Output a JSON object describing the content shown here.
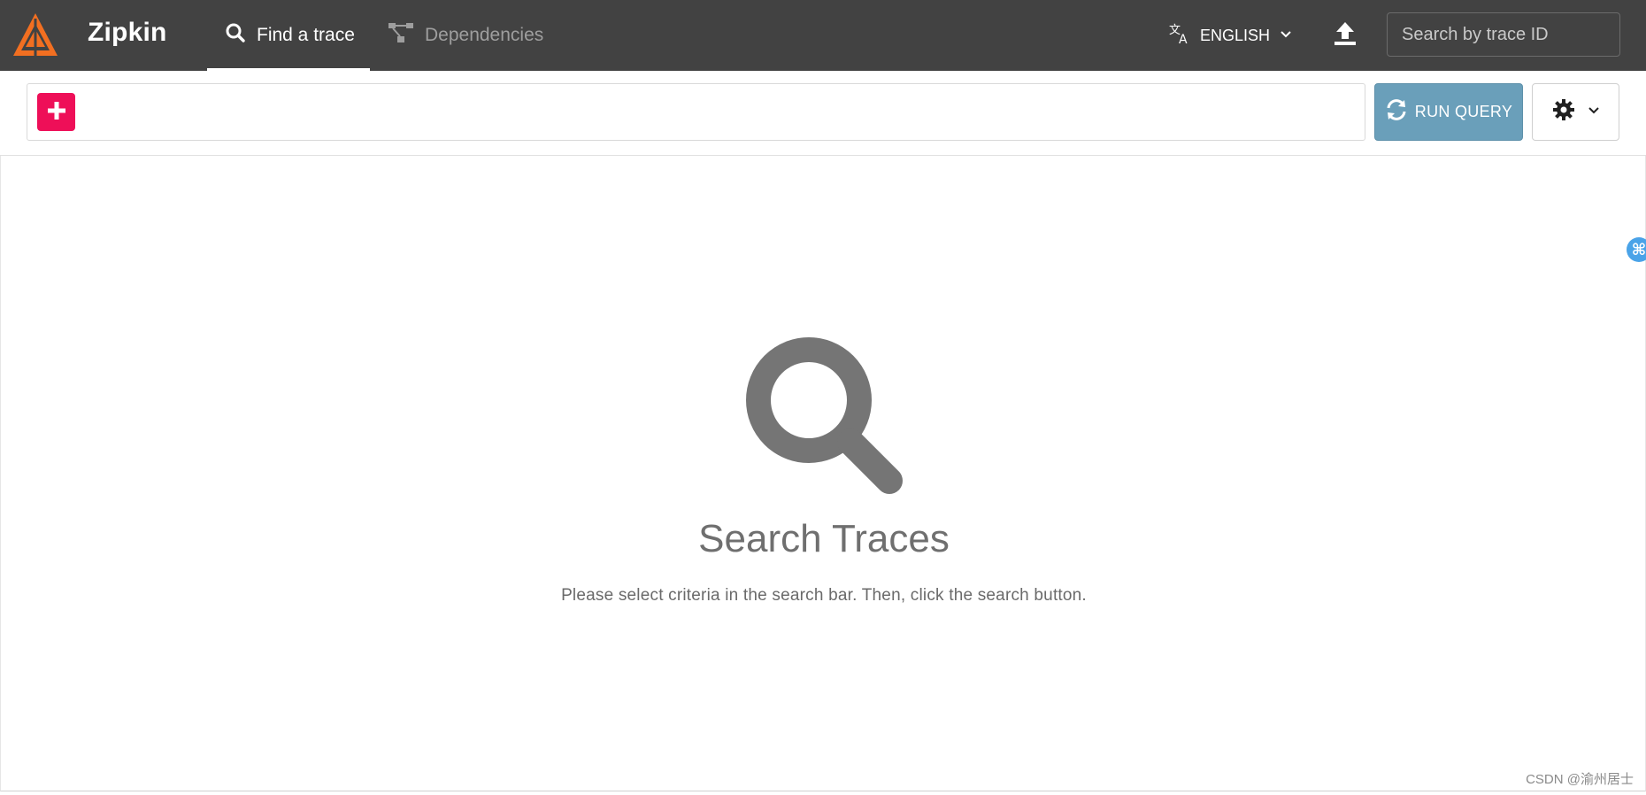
{
  "app": {
    "name": "Zipkin",
    "logo_icon": "zipkin-logo-icon",
    "brand_color": "#f26f21"
  },
  "nav": {
    "tabs": [
      {
        "label": "Find a trace",
        "icon": "search-icon",
        "active": true
      },
      {
        "label": "Dependencies",
        "icon": "dependencies-icon",
        "active": false
      }
    ]
  },
  "header": {
    "language_label": "ENGLISH",
    "language_icon": "translate-icon",
    "upload_icon": "upload-icon",
    "trace_search_placeholder": "Search by trace ID"
  },
  "query": {
    "add_icon": "plus-icon",
    "add_color": "#ee0f58",
    "run_label": "RUN QUERY",
    "run_icon": "refresh-icon",
    "run_color": "#6a9fba",
    "settings_icon": "gear-icon"
  },
  "empty_state": {
    "icon": "search-icon",
    "title": "Search Traces",
    "description": "Please select criteria in the search bar. Then, click the search button."
  },
  "side_badge": {
    "label": "⌘"
  },
  "watermark": "CSDN @渝州居士"
}
